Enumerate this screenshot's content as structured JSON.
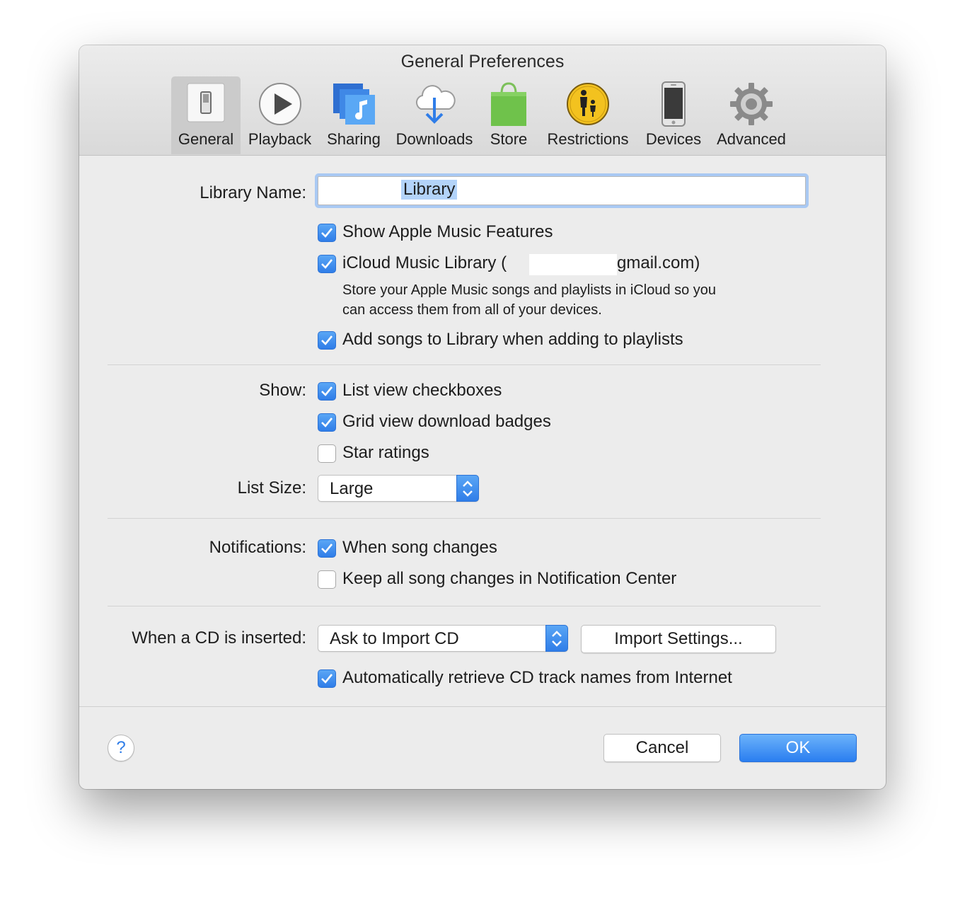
{
  "window": {
    "title": "General Preferences"
  },
  "toolbar": {
    "items": [
      {
        "label": "General",
        "icon": "general-switch-icon",
        "selected": true
      },
      {
        "label": "Playback",
        "icon": "play-icon"
      },
      {
        "label": "Sharing",
        "icon": "sharing-music-icon"
      },
      {
        "label": "Downloads",
        "icon": "cloud-download-icon"
      },
      {
        "label": "Store",
        "icon": "shopping-bag-icon"
      },
      {
        "label": "Restrictions",
        "icon": "parental-controls-icon"
      },
      {
        "label": "Devices",
        "icon": "iphone-icon"
      },
      {
        "label": "Advanced",
        "icon": "gear-icon"
      }
    ]
  },
  "library": {
    "label": "Library Name:",
    "value": "Library",
    "show_apple_music": {
      "label": "Show Apple Music Features",
      "checked": true
    },
    "icloud": {
      "label_prefix": "iCloud Music Library (",
      "label_suffix": "gmail.com)",
      "checked": true
    },
    "icloud_desc_line1": "Store your Apple Music songs and playlists in iCloud so you",
    "icloud_desc_line2": "can access them from all of your devices.",
    "add_songs": {
      "label": "Add songs to Library when adding to playlists",
      "checked": true
    }
  },
  "show": {
    "label": "Show:",
    "list_view_checkboxes": {
      "label": "List view checkboxes",
      "checked": true
    },
    "grid_view_badges": {
      "label": "Grid view download badges",
      "checked": true
    },
    "star_ratings": {
      "label": "Star ratings",
      "checked": false
    }
  },
  "list_size": {
    "label": "List Size:",
    "value": "Large"
  },
  "notifications": {
    "label": "Notifications:",
    "when_song_changes": {
      "label": "When song changes",
      "checked": true
    },
    "keep_all": {
      "label": "Keep all song changes in Notification Center",
      "checked": false
    }
  },
  "cd": {
    "label": "When a CD is inserted:",
    "action": "Ask to Import CD",
    "import_settings": "Import Settings...",
    "auto_retrieve": {
      "label": "Automatically retrieve CD track names from Internet",
      "checked": true
    }
  },
  "footer": {
    "help": "?",
    "cancel": "Cancel",
    "ok": "OK"
  },
  "colors": {
    "accent": "#2f7de8",
    "window_bg": "#ececec"
  }
}
